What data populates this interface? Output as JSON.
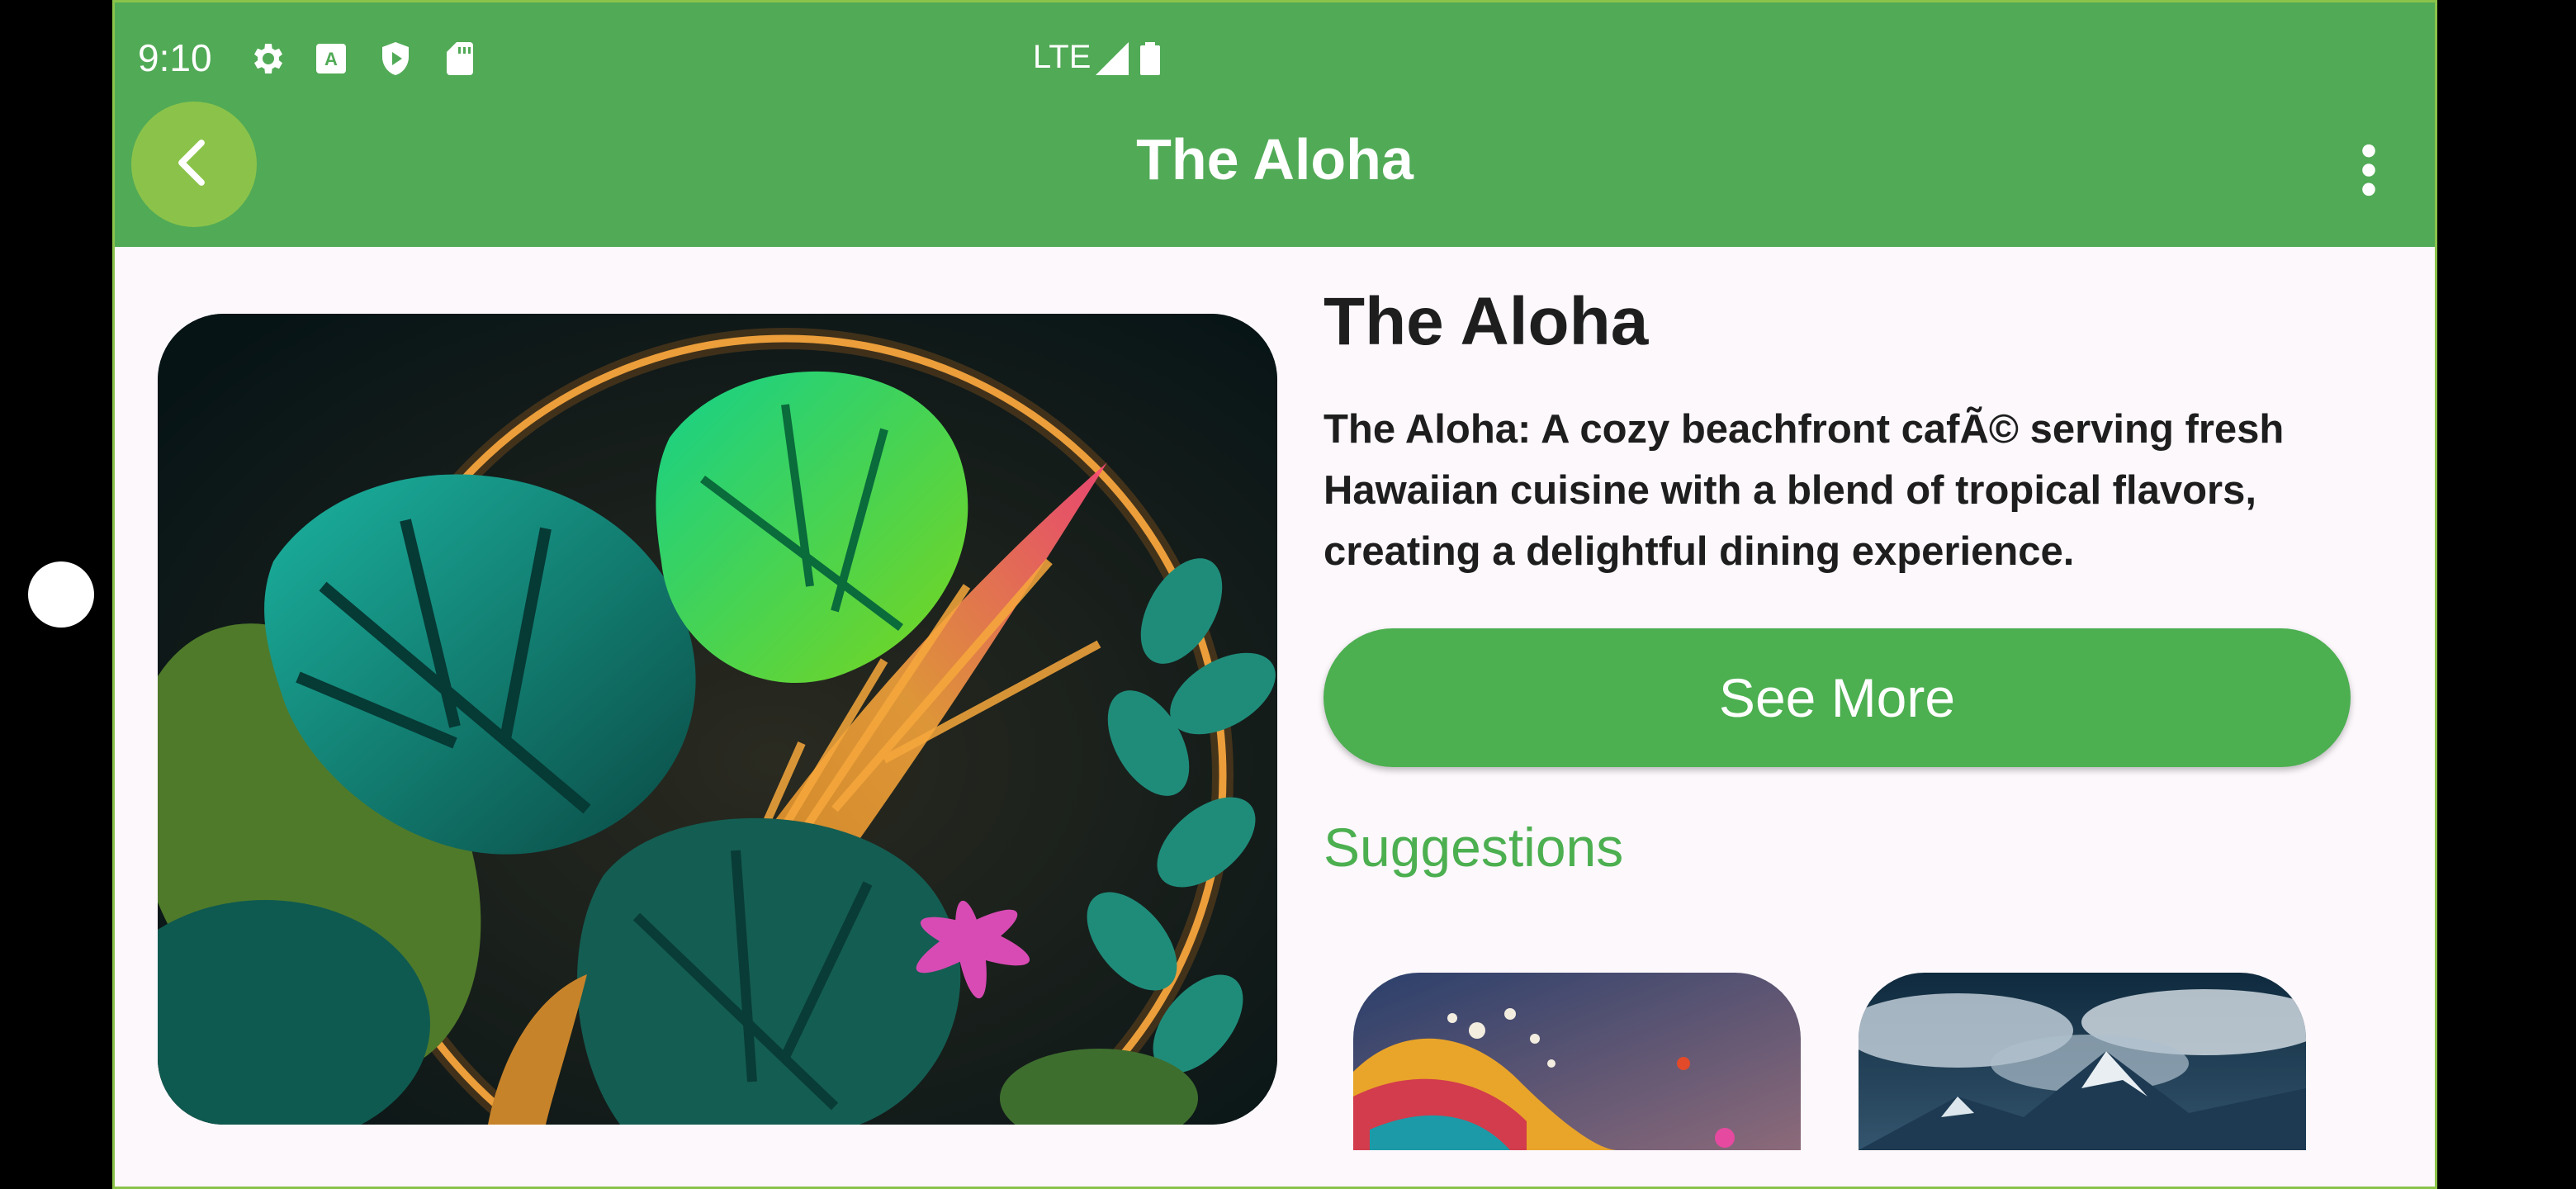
{
  "status_bar": {
    "time": "9:10",
    "network": "LTE",
    "icons": [
      "settings-icon",
      "a-icon",
      "shield-play-icon",
      "sdcard-icon",
      "signal-icon",
      "battery-icon"
    ]
  },
  "app_bar": {
    "title": "The Aloha",
    "back_icon": "back-arrow-icon",
    "menu_icon": "more-vert-icon"
  },
  "content": {
    "heading": "The Aloha",
    "description": "The Aloha: A cozy beachfront cafÃ© serving fresh Hawaiian cuisine with a blend of tropical flavors, creating a delightful dining experience.",
    "see_more_label": "See More",
    "suggestions_label": "Suggestions"
  },
  "colors": {
    "app_bar": "#51aa56",
    "back_button": "#8bc34a",
    "primary_button": "#4caf50",
    "accent_text": "#4caf50",
    "background": "#fcf8fc"
  }
}
